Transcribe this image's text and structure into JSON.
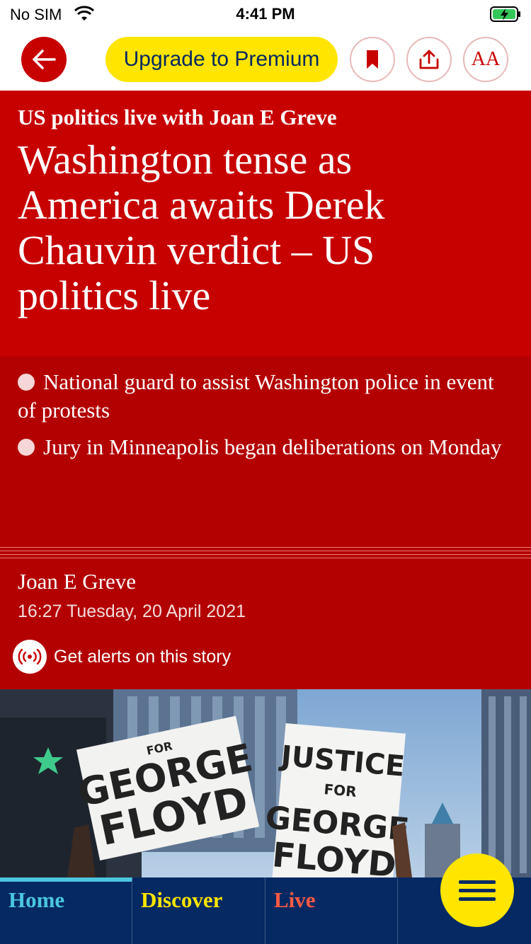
{
  "status_bar": {
    "carrier": "No SIM",
    "time": "4:41 PM"
  },
  "topnav": {
    "premium_label": "Upgrade to Premium",
    "text_size_label": "AA"
  },
  "article": {
    "kicker": "US politics live with Joan E Greve",
    "headline": "Washington tense as America awaits Derek Chauvin verdict – US politics live",
    "standfirst": [
      "National guard to assist Washington police in event of protests",
      "Jury in Minneapolis began deliberations on Monday"
    ],
    "author": "Joan E Greve",
    "dateline": "16:27 Tuesday, 20 April 2021",
    "alerts_label": "Get alerts on this story"
  },
  "photo": {
    "sign1_line1": "FOR",
    "sign1_line2": "GEORGE",
    "sign1_line3": "FLOYD",
    "sign2_line1": "JUSTICE",
    "sign2_line2": "FOR",
    "sign2_line3": "GEORGE",
    "sign2_line4": "FLOYD"
  },
  "bottomnav": {
    "tabs": [
      {
        "label": "Home",
        "color": "#4bc6df"
      },
      {
        "label": "Discover",
        "color": "#ffe500"
      },
      {
        "label": "Live",
        "color": "#ff5943"
      }
    ]
  },
  "colors": {
    "accent_red": "#c70000",
    "premium_yellow": "#ffe500",
    "nav_blue": "#052962"
  }
}
